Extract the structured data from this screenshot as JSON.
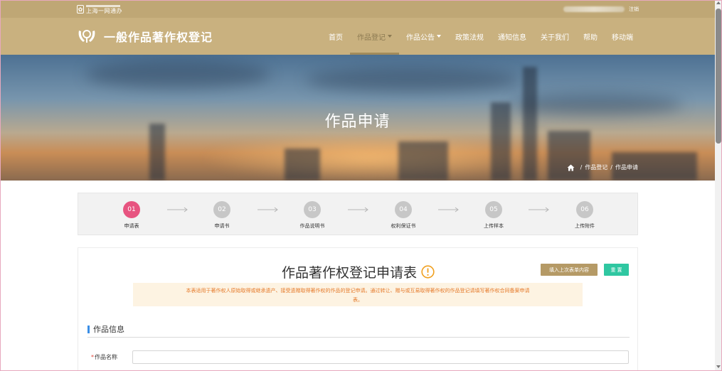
{
  "topbar": {
    "mini_logo_text": "上海一网通办",
    "user_name": "",
    "logout_label": "注销"
  },
  "header": {
    "brand_title": "一般作品著作权登记",
    "nav": [
      {
        "label": "首页",
        "dropdown": false,
        "active": false
      },
      {
        "label": "作品登记",
        "dropdown": true,
        "active": true
      },
      {
        "label": "作品公告",
        "dropdown": true,
        "active": false
      },
      {
        "label": "政策法规",
        "dropdown": false,
        "active": false
      },
      {
        "label": "通知信息",
        "dropdown": false,
        "active": false
      },
      {
        "label": "关于我们",
        "dropdown": false,
        "active": false
      },
      {
        "label": "帮助",
        "dropdown": false,
        "active": false
      },
      {
        "label": "移动端",
        "dropdown": false,
        "active": false
      }
    ]
  },
  "hero": {
    "title": "作品申请",
    "breadcrumb": [
      "作品登记",
      "作品申请"
    ]
  },
  "steps": [
    {
      "num": "01",
      "label": "申请表",
      "active": true
    },
    {
      "num": "02",
      "label": "申请书",
      "active": false
    },
    {
      "num": "03",
      "label": "作品说明书",
      "active": false
    },
    {
      "num": "04",
      "label": "权利保证书",
      "active": false
    },
    {
      "num": "05",
      "label": "上传样本",
      "active": false
    },
    {
      "num": "06",
      "label": "上传附件",
      "active": false
    }
  ],
  "form": {
    "title": "作品著作权登记申请表",
    "fill_last_label": "填入上次表单内容",
    "reset_label": "重 置",
    "notice_line1": "本表适用于著作权人原始取得或继承遗产、接受遗赠取得著作权的作品的登记申请。通过转让、赠与或互易取得著作权的作品登记请填写著作权合同备案申请",
    "notice_line2": "表。",
    "section_title": "作品信息",
    "fields": [
      {
        "label": "作品名称",
        "required": true,
        "value": "",
        "placeholder": ""
      }
    ]
  },
  "colors": {
    "topstrip": "#bfa775",
    "navbar": "#c9b17f",
    "step_active": "#e75480",
    "step_inactive": "#c7c7c7",
    "fill_button": "#b59a66",
    "reset_button": "#2fc7a1",
    "notice_text": "#e57a2a",
    "section_accent": "#3a8ee6"
  }
}
